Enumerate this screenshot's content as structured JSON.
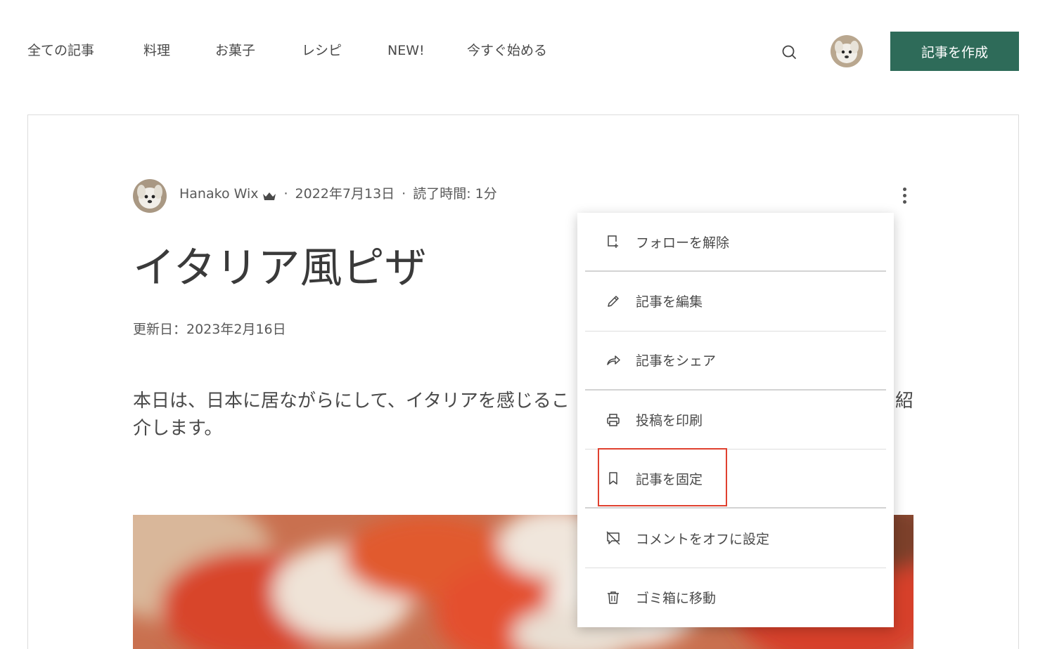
{
  "nav": {
    "items": [
      "全ての記事",
      "料理",
      "お菓子",
      "レシピ",
      "NEW!",
      "今すぐ始める"
    ]
  },
  "header": {
    "search_icon": "search-icon",
    "create_label": "記事を作成",
    "brand_color": "#2e6b59"
  },
  "post": {
    "author": "Hanako Wix",
    "author_badge_icon": "crown-icon",
    "date": "2022年7月13日",
    "read_time": "読了時間: 1分",
    "title": "イタリア風ピザ",
    "updated": "更新日：2023年2月16日",
    "body": "本日は、日本に居ながらにして、イタリアを感じるこ",
    "body_tail": "紹",
    "body_line2": "介します。"
  },
  "menu": {
    "items": [
      {
        "label": "フォローを解除",
        "icon": "unfollow-post-icon"
      },
      {
        "label": "記事を編集",
        "icon": "pencil-icon"
      },
      {
        "label": "記事をシェア",
        "icon": "share-arrow-icon"
      },
      {
        "label": "投稿を印刷",
        "icon": "printer-icon"
      },
      {
        "label": "記事を固定",
        "icon": "bookmark-icon"
      },
      {
        "label": "コメントをオフに設定",
        "icon": "comments-off-icon"
      },
      {
        "label": "ゴミ箱に移動",
        "icon": "trash-icon"
      }
    ],
    "highlight_color": "#e0412f"
  }
}
